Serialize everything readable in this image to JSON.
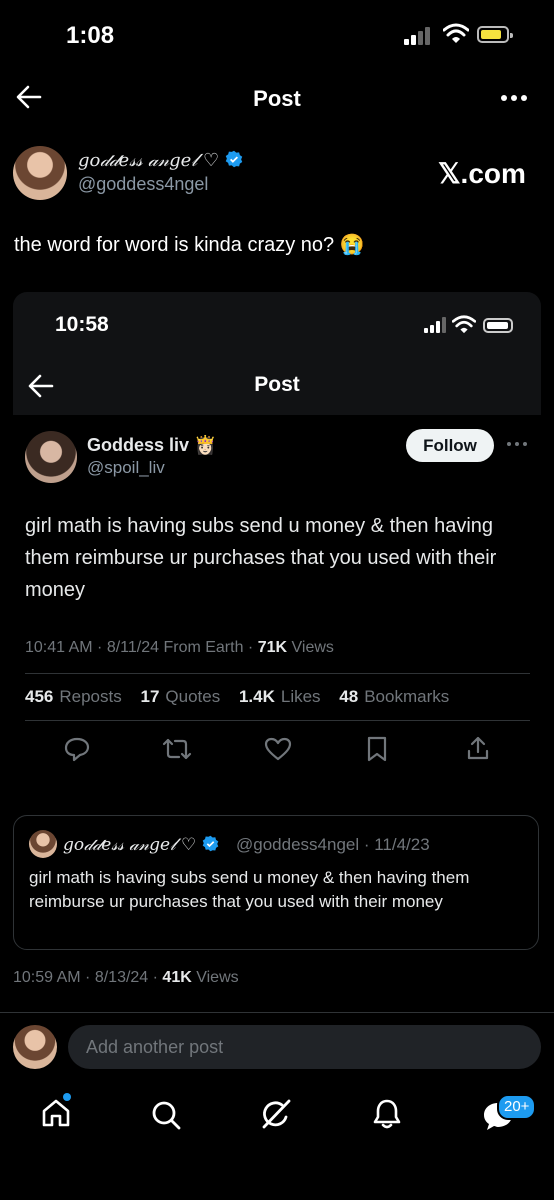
{
  "status": {
    "time": "1:08"
  },
  "nav": {
    "title": "Post"
  },
  "author": {
    "name": "𝑔𝑜𝒹𝒹𝑒𝓈𝓈 𝒶𝓃𝑔𝑒𝓁 ♡",
    "handle": "@goddess4ngel",
    "watermark": "𝕏.com"
  },
  "post": {
    "text": "the word for word is kinda crazy no? 😭"
  },
  "screenshot": {
    "time": "10:58",
    "title": "Post",
    "author": {
      "name": "Goddess liv 👸🏻",
      "handle": "@spoil_liv"
    },
    "follow_label": "Follow",
    "body": "girl math is having subs send u money & then having them reimburse ur purchases that you used with their money",
    "meta_prefix": "10:41 AM · 8/11/24 From Earth · ",
    "views_count": "71K",
    "views_label": " Views",
    "stats": [
      {
        "count": "456",
        "label": "Reposts"
      },
      {
        "count": "17",
        "label": "Quotes"
      },
      {
        "count": "1.4K",
        "label": "Likes"
      },
      {
        "count": "48",
        "label": "Bookmarks"
      }
    ]
  },
  "quote": {
    "name": "𝑔𝑜𝒹𝒹𝑒𝓈𝓈 𝒶𝓃𝑔𝑒𝓁 ♡",
    "handle_date": "@goddess4ngel · 11/4/23",
    "body": "girl math is having subs send u money & then having them reimburse ur purchases that you used with their money"
  },
  "post_meta": {
    "prefix": "10:59 AM · 8/13/24 · ",
    "views_count": "41K",
    "views_label": " Views"
  },
  "reply": {
    "placeholder": "Add another post"
  },
  "tabbar": {
    "messages_badge": "20+"
  },
  "colors": {
    "accent": "#1d9bf0",
    "background": "#000000"
  }
}
